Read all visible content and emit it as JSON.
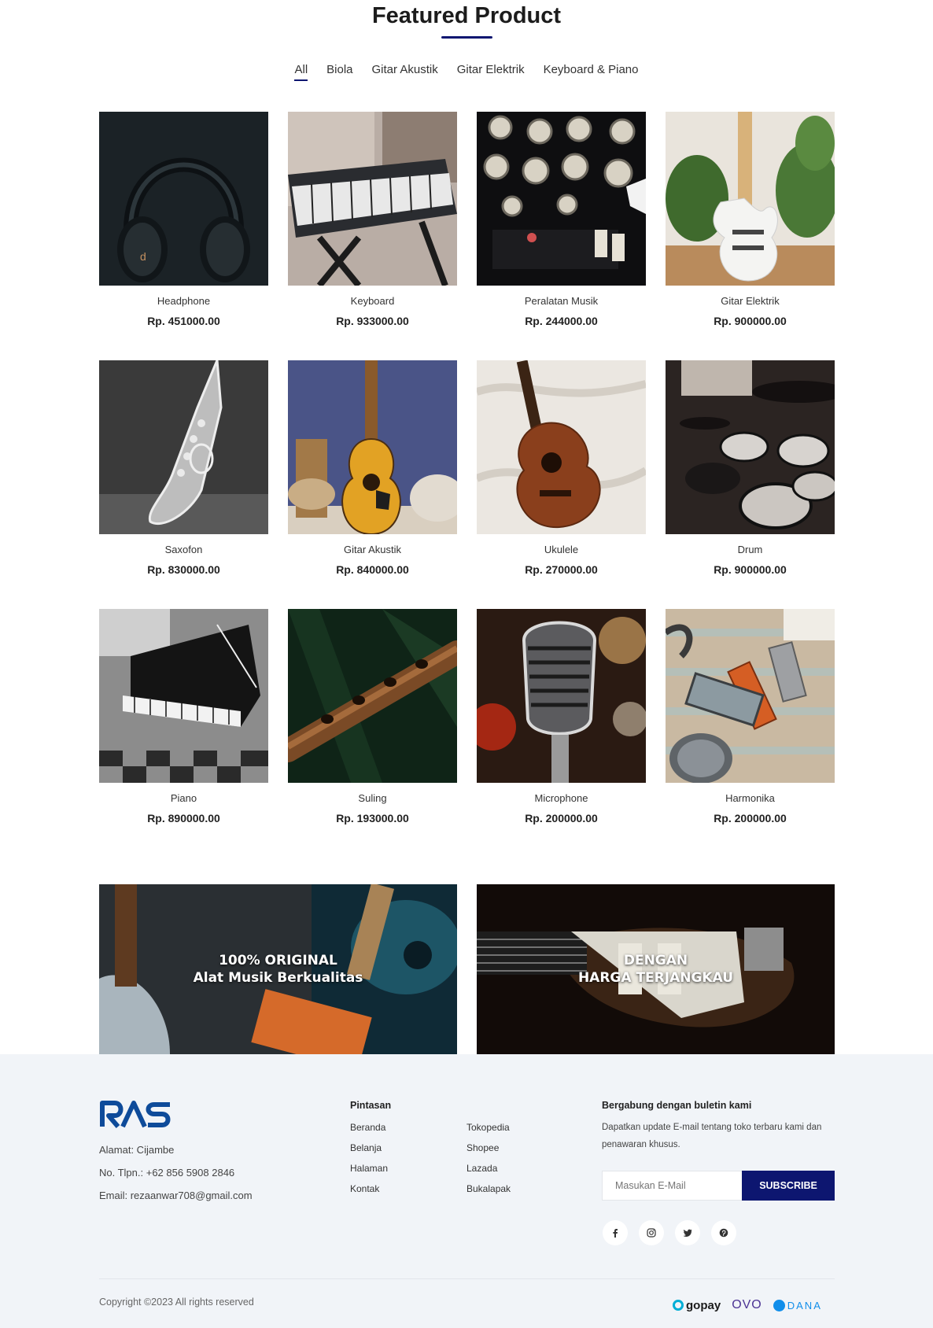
{
  "section": {
    "title": "Featured Product"
  },
  "filters": [
    "All",
    "Biola",
    "Gitar Akustik",
    "Gitar Elektrik",
    "Keyboard & Piano"
  ],
  "products": [
    {
      "name": "Headphone",
      "price": "Rp. 451000.00"
    },
    {
      "name": "Keyboard",
      "price": "Rp. 933000.00"
    },
    {
      "name": "Peralatan Musik",
      "price": "Rp. 244000.00"
    },
    {
      "name": "Gitar Elektrik",
      "price": "Rp. 900000.00"
    },
    {
      "name": "Saxofon",
      "price": "Rp. 830000.00"
    },
    {
      "name": "Gitar Akustik",
      "price": "Rp. 840000.00"
    },
    {
      "name": "Ukulele",
      "price": "Rp. 270000.00"
    },
    {
      "name": "Drum",
      "price": "Rp. 900000.00"
    },
    {
      "name": "Piano",
      "price": "Rp. 890000.00"
    },
    {
      "name": "Suling",
      "price": "Rp. 193000.00"
    },
    {
      "name": "Microphone",
      "price": "Rp. 200000.00"
    },
    {
      "name": "Harmonika",
      "price": "Rp. 200000.00"
    }
  ],
  "banners": [
    {
      "line1": "100% ORIGINAL",
      "line2": "Alat Musik Berkualitas"
    },
    {
      "line1": "DENGAN",
      "line2": "HARGA TERJANGKAU"
    }
  ],
  "footer": {
    "logo_text": "RAS",
    "address": "Alamat: Cijambe",
    "phone": "No. Tlpn.: +62 856 5908 2846",
    "email": "Email: rezaanwar708@gmail.com",
    "links_heading": "Pintasan",
    "links_col1": [
      "Beranda",
      "Belanja",
      "Halaman",
      "Kontak"
    ],
    "links_col2": [
      "Tokopedia",
      "Shopee",
      "Lazada",
      "Bukalapak"
    ],
    "newsletter_heading": "Bergabung dengan buletin kami",
    "newsletter_desc": "Dapatkan update E-mail tentang toko terbaru kami dan penawaran khusus.",
    "email_placeholder": "Masukan E-Mail",
    "subscribe_label": "SUBSCRIBE",
    "socials": [
      "facebook-icon",
      "instagram-icon",
      "twitter-icon",
      "pinterest-icon"
    ],
    "copyright": "Copyright ©2023 All rights reserved",
    "payments": [
      "gopay",
      "OVO",
      "DANA"
    ]
  },
  "colors": {
    "accent": "#0d1670",
    "footer_bg": "#f1f4f8"
  }
}
